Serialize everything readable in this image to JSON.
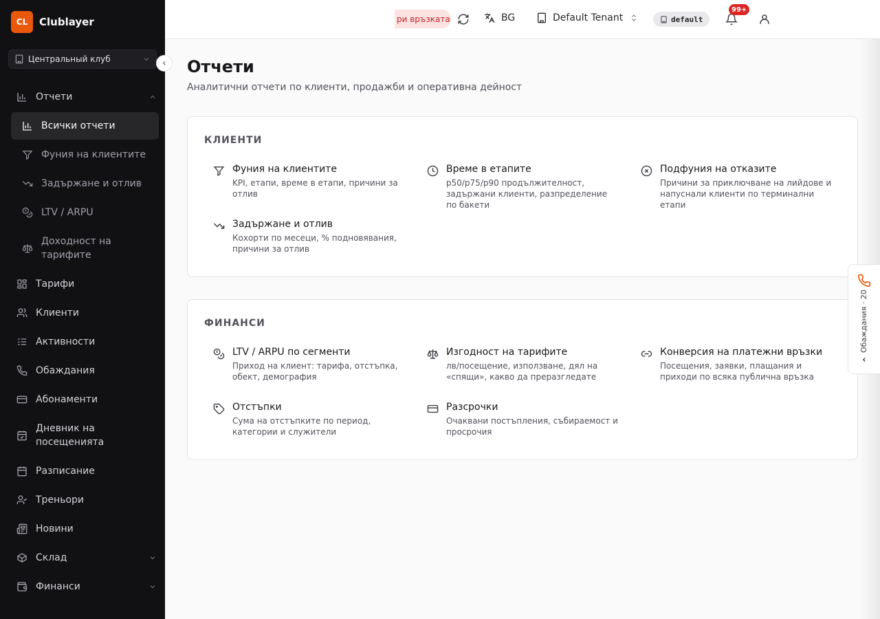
{
  "brand": {
    "logo": "CL",
    "name": "Clublayer",
    "logo_color": "#ea580c"
  },
  "club_select": {
    "value": "Центральный клуб"
  },
  "sidebar": {
    "reports": {
      "label": "Отчети"
    },
    "sub_items": [
      {
        "label": "Всички отчети",
        "icon": "bar-chart-icon",
        "active": true
      },
      {
        "label": "Фуния на клиентите",
        "icon": "funnel-icon"
      },
      {
        "label": "Задържане и отлив",
        "icon": "trending-down-icon"
      },
      {
        "label": "LTV / ARPU",
        "icon": "coins-icon"
      },
      {
        "label": "Доходност на тарифите",
        "icon": "scale-icon"
      }
    ],
    "items": [
      {
        "label": "Тарифи",
        "icon": "grid-icon"
      },
      {
        "label": "Клиенти",
        "icon": "users-icon"
      },
      {
        "label": "Активности",
        "icon": "list-icon"
      },
      {
        "label": "Обаждания",
        "icon": "phone-icon"
      },
      {
        "label": "Абонаменти",
        "icon": "credit-card-icon"
      },
      {
        "label": "Дневник на посещенията",
        "icon": "calendar-check-icon"
      },
      {
        "label": "Разписание",
        "icon": "calendar-icon"
      },
      {
        "label": "Треньори",
        "icon": "user-check-icon"
      },
      {
        "label": "Новини",
        "icon": "newspaper-icon"
      },
      {
        "label": "Склад",
        "icon": "box-icon",
        "expandable": true
      },
      {
        "label": "Финанси",
        "icon": "wallet-icon",
        "expandable": true
      }
    ]
  },
  "header": {
    "connection_status": "ри връзката",
    "language": "BG",
    "tenant": "Default Tenant",
    "env_badge": "default",
    "notifications_count": "99+"
  },
  "page": {
    "title": "Отчети",
    "subtitle": "Аналитични отчети по клиенти, продажби и оперативна дейност"
  },
  "sections": [
    {
      "title": "КЛИЕНТИ",
      "reports": [
        {
          "title": "Фуния на клиентите",
          "desc": "KPI, етапи, време в етапи, причини за отлив",
          "icon": "funnel-icon"
        },
        {
          "title": "Време в етапите",
          "desc": "p50/p75/p90 продължителност, задържани клиенти, разпределение по бакети",
          "icon": "clock-icon"
        },
        {
          "title": "Подфуния на отказите",
          "desc": "Причини за приключване на лийдове и напуснали клиенти по терминални етапи",
          "icon": "x-circle-icon"
        },
        {
          "title": "Задържане и отлив",
          "desc": "Кохорти по месеци, % подновявания, причини за отлив",
          "icon": "trending-down-icon"
        }
      ]
    },
    {
      "title": "ФИНАНСИ",
      "reports": [
        {
          "title": "LTV / ARPU по сегменти",
          "desc": "Приход на клиент: тарифа, отстъпка, обект, демография",
          "icon": "coins-icon"
        },
        {
          "title": "Изгодност на тарифите",
          "desc": "лв/посещение, използване, дял на «спящи», какво да преразгледате",
          "icon": "scale-icon"
        },
        {
          "title": "Конверсия на платежни връзки",
          "desc": "Посещения, заявки, плащания и приходи по всяка публична връзка",
          "icon": "link-icon"
        },
        {
          "title": "Отстъпки",
          "desc": "Сума на отстъпките по период, категории и служители",
          "icon": "tag-icon"
        },
        {
          "title": "Разсрочки",
          "desc": "Очаквани постъпления, събираемост и просрочия",
          "icon": "credit-card-icon"
        }
      ]
    }
  ],
  "calls_panel": {
    "label": "Обаждания · 20",
    "accent": "#ea580c"
  }
}
